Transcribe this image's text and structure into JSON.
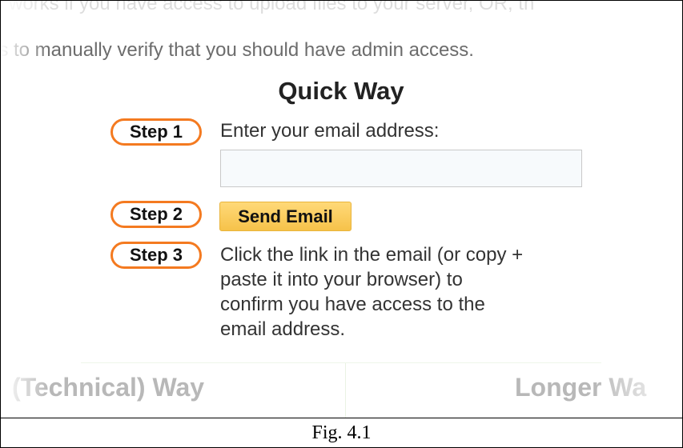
{
  "top_text": {
    "line1": "works if you have access to upload files to your server, OR, th",
    "line2": "is to manually verify that you should have admin access."
  },
  "quick_way": {
    "title": "Quick Way",
    "steps": [
      {
        "badge": "Step 1",
        "text": "Enter your email address:"
      },
      {
        "badge": "Step 2"
      },
      {
        "badge": "Step 3",
        "text_lines": [
          "Click the link in the email (or copy +",
          "paste it into your browser) to",
          "confirm you have access to the",
          "email address."
        ]
      }
    ],
    "email_input": {
      "value": "",
      "placeholder": ""
    },
    "send_button_label": "Send Email"
  },
  "bottom_headings": {
    "left": "(Technical) Way",
    "right": "Longer Wa"
  },
  "caption": "Fig. 4.1",
  "colors": {
    "step_border": "#f47a20",
    "button_bg": "#f6c24a",
    "input_bg": "#f7fafc"
  }
}
